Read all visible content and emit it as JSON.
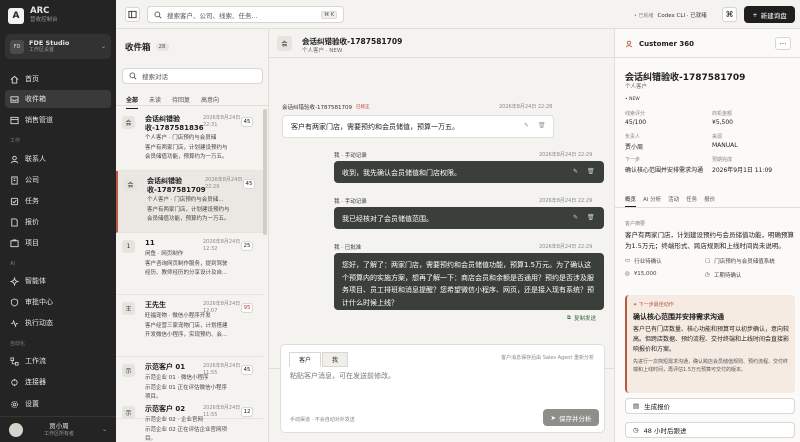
{
  "brand": {
    "name": "ARC",
    "subtitle": "营收控制台",
    "logo": "A"
  },
  "workspace": {
    "badge": "FD",
    "name": "FDE Studio",
    "subtitle": "工作区设置"
  },
  "nav": {
    "main": [
      {
        "label": "首页",
        "icon": "home-icon"
      },
      {
        "label": "收件箱",
        "icon": "inbox-icon",
        "active": true
      },
      {
        "label": "销售管道",
        "icon": "pipeline-icon"
      }
    ],
    "work_section": "工作",
    "work": [
      {
        "label": "联系人",
        "icon": "contacts-icon"
      },
      {
        "label": "公司",
        "icon": "building-icon"
      },
      {
        "label": "任务",
        "icon": "tasks-icon"
      },
      {
        "label": "报价",
        "icon": "quote-icon"
      },
      {
        "label": "项目",
        "icon": "project-icon"
      }
    ],
    "ai_section": "AI",
    "ai": [
      {
        "label": "智能体",
        "icon": "agent-icon"
      },
      {
        "label": "审批中心",
        "icon": "approval-icon"
      },
      {
        "label": "执行动态",
        "icon": "activity-icon"
      }
    ],
    "auto_section": "自动化",
    "auto": [
      {
        "label": "工作流",
        "icon": "workflow-icon"
      },
      {
        "label": "连接器",
        "icon": "connector-icon"
      },
      {
        "label": "设置",
        "icon": "settings-icon"
      }
    ]
  },
  "user": {
    "name": "贾小周",
    "role": "工作区所有者"
  },
  "topbar": {
    "search_placeholder": "搜索客户、公司、线索、任务...",
    "shortcut": "⌘ K",
    "status_prefix": "• 已就绪",
    "status_text": "Codex CLI · 已就绪",
    "new_button": "新建询盘"
  },
  "inbox": {
    "title": "收件箱",
    "count": "28",
    "search_placeholder": "搜索对话",
    "tabs": [
      "全部",
      "未读",
      "待回复",
      "高意向"
    ],
    "items": [
      {
        "avatar": "会",
        "name": "会话纠错验收-1787581836",
        "time": "2026年8月24日 22:31",
        "badge": "45",
        "line1": "个人客户 · 门店预约与会员储",
        "line2": "客户有两家门店，计划建设预约与",
        "line3": "会员储值功能，预算约为一万五。"
      },
      {
        "avatar": "会",
        "name": "会话纠错验收-1787581709",
        "time": "2026年8月24日 22:29",
        "badge": "45",
        "active": true,
        "line1": "个人客户 · 门店预约与会员储...",
        "line2": "客户有两家门店，计划建设预约与",
        "line3": "会员储值功能，预算约为一万五。"
      },
      {
        "avatar": "1",
        "name": "11",
        "time": "2026年8月24日 12:32",
        "badge": "25",
        "line1": "闲鱼 · 网页制作",
        "line2": "客户咨询网页制作服务，提到驾驶",
        "line3": "经历、教师经历的分享设计及自..."
      },
      {
        "avatar": "王",
        "name": "王先生",
        "time": "2026年8月24日 12:07",
        "badge": "95",
        "badge_warn": true,
        "line1": "旺福宠物 · 微信小程序开发",
        "line2": "客户经营三家宠物门店，计划搭建",
        "line3": "开发微信小程序，实现预约、会..."
      },
      {
        "avatar": "示",
        "name": "示范客户 01",
        "time": "2026年8月24日 11:55",
        "badge": "45",
        "line1": "示范企业 01 · 微信小程序",
        "line2": "示范企业 01 正在评估微信小程序",
        "line3": "项目。"
      },
      {
        "avatar": "示",
        "name": "示范客户 02",
        "time": "2026年8月24日 11:55",
        "badge": "12",
        "line1": "示范企业 02 · 企业官网",
        "line2": "示范企业 02 正在评估企业官网项",
        "line3": "目。"
      }
    ]
  },
  "chat": {
    "avatar": "会",
    "title": "会话纠错验收-1787581709",
    "subtitle": "个人客户 · NEW",
    "incoming": {
      "sender": "会话纠错验收-1787581709",
      "tag": "已修正",
      "time": "2026年8月24日 22:28",
      "text": "客户有两家门店，需要预约和会员储值，预算一万五。"
    },
    "outgoing": [
      {
        "sender": "我 · 手动记录",
        "time": "2026年8月24日 22:29",
        "text": "收到，我先确认会员储值和门店权限。"
      },
      {
        "sender": "我 · 手动记录",
        "time": "2026年8月24日 22:29",
        "text": "我已经核对了会员储值范围。"
      },
      {
        "sender": "我 · 已批准",
        "time": "2026年8月24日 22:29",
        "text": "您好，了解了：两家门店，需要预约和会员储值功能，预算1.5万元。为了确认这个预算内的实施方案，想再了解一下：商店会员和余额是否通用？预约是否涉及服务项目、员工排班和消息提醒？您希望微信小程序、网页，还是接入现有系统？预计什么时候上线？"
      }
    ],
    "copy_label": "复制发送",
    "composer": {
      "tabs": [
        "客户",
        "我"
      ],
      "hint": "客户消息保存后由 Sales Agent 重新分析",
      "placeholder": "粘贴客户消息，可在发送前修改。",
      "footer": "手动渠道 · 不会自动对外发送",
      "send": "保存并分析"
    }
  },
  "customer": {
    "title": "Customer 360",
    "name": "会话纠错验收-1787581709",
    "type": "个人客户",
    "stage": "NEW",
    "fields": [
      {
        "label": "线索评分",
        "value": "45/100"
      },
      {
        "label": "商机金额",
        "value": "¥5,500"
      },
      {
        "label": "负责人",
        "value": "贾小周"
      },
      {
        "label": "来源",
        "value": "MANUAL"
      },
      {
        "label": "下一步",
        "value": "确认核心范围并安排需求沟通"
      },
      {
        "label": "预期完成",
        "value": "2026年9月1日 11:09"
      }
    ],
    "tabs": [
      "概览",
      "AI 分析",
      "活动",
      "任务",
      "报价"
    ],
    "summary_label": "客户摘要",
    "summary": "客户有两家门店，计划建设预约与会员储值功能，明确预算为1.5万元；终端形式、跨店规则和上线时间尚未说明。",
    "tags": [
      "行业待确认",
      "门店预约与会员储值系统",
      "¥15,000",
      "工期待确认"
    ],
    "nba": {
      "tag": "下一步最佳动作",
      "title": "确认核心范围并安排需求沟通",
      "text": "客户已有门店数量、核心功能和预算可以初步确认，意向较高。但跨店数据、预约流程、交付终端和上线时间会直接影响报价和方案。",
      "small": "先进行一次简短需求沟通，确认跨店会员储值规则、预约流程、交付终端和上线时间，再评估1.5万元预算可交付的版本。"
    },
    "actions": [
      "生成报价",
      "48 小时后跟进"
    ]
  }
}
